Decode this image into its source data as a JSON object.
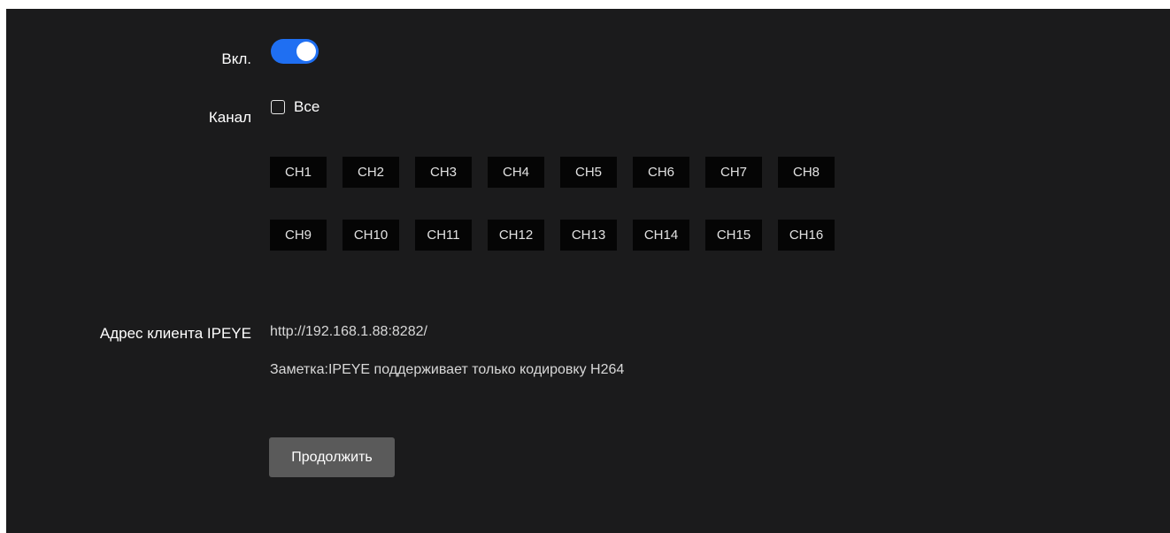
{
  "form": {
    "enable": {
      "label": "Вкл.",
      "checked": true,
      "accent_color": "#1f6ff2"
    },
    "channel": {
      "label": "Канал",
      "all_label": "Все",
      "all_checked": false,
      "channels_row1": [
        "CH1",
        "CH2",
        "CH3",
        "CH4",
        "CH5",
        "CH6",
        "CH7",
        "CH8"
      ],
      "channels_row2": [
        "CH9",
        "CH10",
        "CH11",
        "CH12",
        "CH13",
        "CH14",
        "CH15",
        "CH16"
      ]
    },
    "client_address": {
      "label": "Адрес клиента IPEYE",
      "value": "http://192.168.1.88:8282/",
      "note": "Заметка:IPEYE поддерживает только кодировку H264"
    },
    "continue_label": "Продолжить"
  }
}
